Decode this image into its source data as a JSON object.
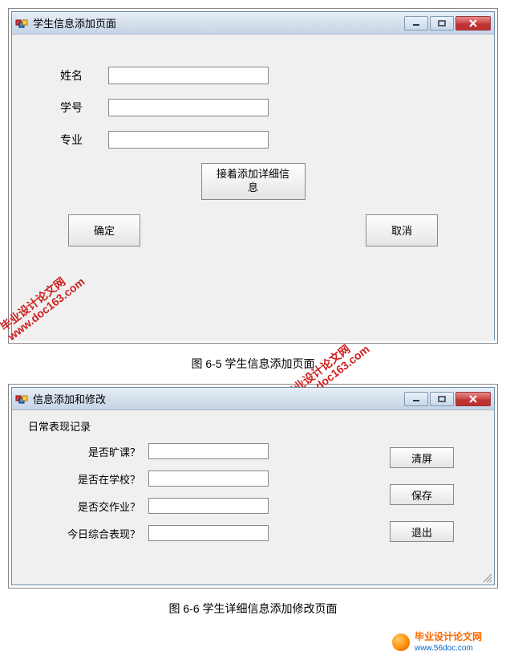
{
  "window1": {
    "title": "学生信息添加页面",
    "fields": {
      "name_label": "姓名",
      "name_value": "",
      "id_label": "学号",
      "id_value": "",
      "major_label": "专业",
      "major_value": ""
    },
    "buttons": {
      "detail": "接着添加详细信息",
      "ok": "确定",
      "cancel": "取消"
    }
  },
  "caption1": "图 6-5 学生信息添加页面",
  "window2": {
    "title": "信息添加和修改",
    "section_label": "日常表现记录",
    "fields": {
      "q1_label": "是否旷课？",
      "q1_value": "",
      "q2_label": "是否在学校？",
      "q2_value": "",
      "q3_label": "是否交作业？",
      "q3_value": "",
      "q4_label": "今日综合表现？",
      "q4_value": ""
    },
    "buttons": {
      "clear": "清屏",
      "save": "保存",
      "exit": "退出"
    }
  },
  "caption2": "图 6-6 学生详细信息添加修改页面",
  "watermark": {
    "line1": "毕业设计论文网",
    "line2": "www.doc163.com"
  },
  "footer": {
    "brand": "毕业设计论文网",
    "url": "www.56doc.com"
  }
}
